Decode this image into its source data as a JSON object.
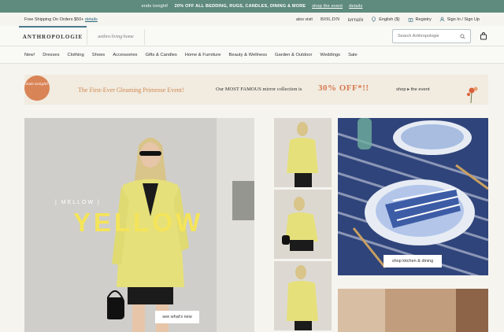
{
  "promo": {
    "ends": "ends tonight!",
    "offer": "20% OFF ALL BEDDING, RUGS, CANDLES, DINING & MORE",
    "shop_link": "shop the event",
    "details": "details"
  },
  "util": {
    "shipping": "Free Shipping On Orders $50+",
    "shipping_details": "details",
    "also_visit": "also visit",
    "bhldn": "BHLDN",
    "terrain": "terrain",
    "language": "English ($)",
    "registry": "Registry",
    "signin": "Sign In / Sign Up"
  },
  "header": {
    "logo": "ANTHROPOLOGIE",
    "sublogo": "anthro·living·home",
    "search_placeholder": "Search Anthropologie"
  },
  "nav": {
    "items": [
      "New!",
      "Dresses",
      "Clothing",
      "Shoes",
      "Accessories",
      "Gifts & Candles",
      "Home & Furniture",
      "Beauty & Wellness",
      "Garden & Outdoor",
      "Weddings",
      "Sale"
    ]
  },
  "banner": {
    "badge": "ends tonight!",
    "title": "The First-Ever Gleaming Primrose Event!",
    "lead": "Our MOST FAMOUS mirror collection is",
    "pct": "30% OFF*!!",
    "cta": "shop ▸ the event"
  },
  "hero": {
    "kicker": "| MELLOW |",
    "headline": "YELLOW",
    "cta": "see what's new"
  },
  "product": {
    "cta": "shop kitchen & dining"
  },
  "colors": {
    "promo_bg": "#5f8a7e",
    "accent": "#d6794e",
    "yellow": "#f4e45a"
  }
}
